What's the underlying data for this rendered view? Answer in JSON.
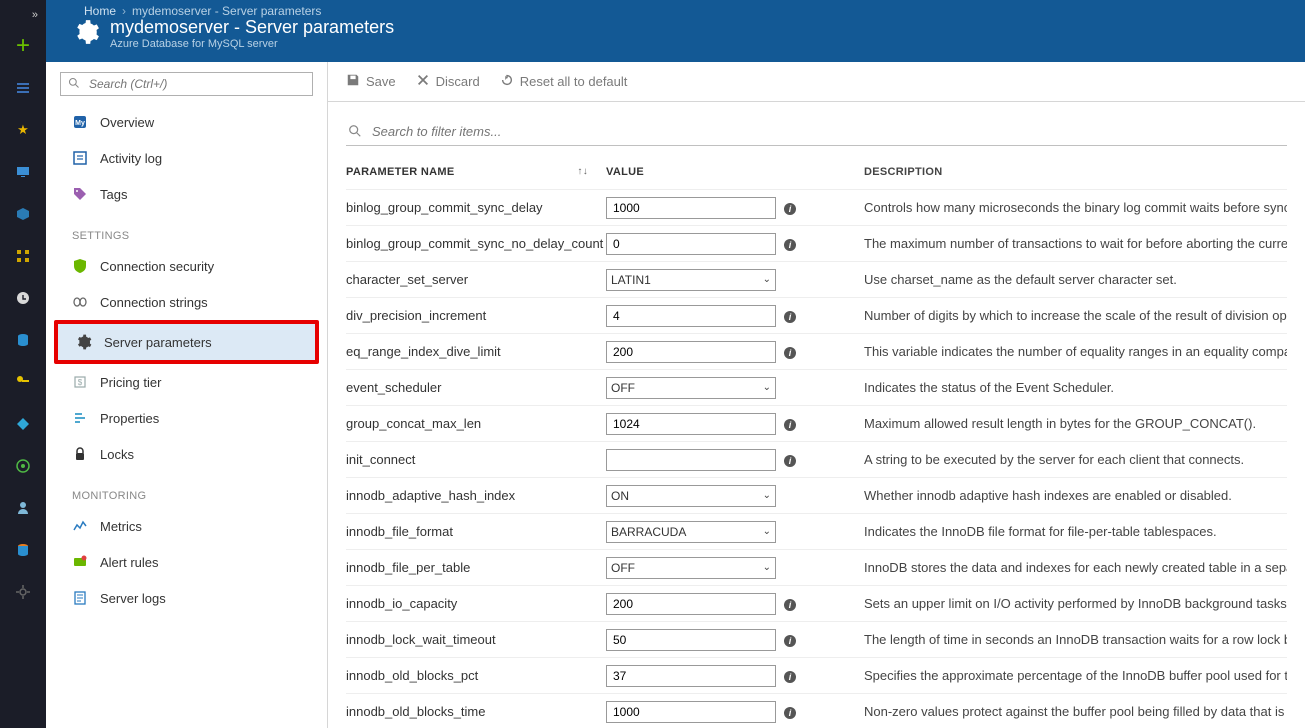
{
  "breadcrumb": {
    "home": "Home",
    "current": "mydemoserver - Server parameters"
  },
  "header": {
    "title": "mydemoserver - Server parameters",
    "subtitle": "Azure Database for MySQL server"
  },
  "sidebar": {
    "search_placeholder": "Search (Ctrl+/)",
    "top_items": [
      {
        "label": "Overview",
        "icon": "db-icon"
      },
      {
        "label": "Activity log",
        "icon": "activitylog-icon"
      },
      {
        "label": "Tags",
        "icon": "tag-icon"
      }
    ],
    "settings_label": "SETTINGS",
    "settings_items": [
      {
        "label": "Connection security",
        "icon": "shield-icon"
      },
      {
        "label": "Connection strings",
        "icon": "connstring-icon"
      },
      {
        "label": "Server parameters",
        "icon": "gear-icon",
        "active": true
      },
      {
        "label": "Pricing tier",
        "icon": "pricing-icon"
      },
      {
        "label": "Properties",
        "icon": "properties-icon"
      },
      {
        "label": "Locks",
        "icon": "lock-icon"
      }
    ],
    "monitoring_label": "MONITORING",
    "monitoring_items": [
      {
        "label": "Metrics",
        "icon": "metrics-icon"
      },
      {
        "label": "Alert rules",
        "icon": "alert-icon"
      },
      {
        "label": "Server logs",
        "icon": "logs-icon"
      }
    ]
  },
  "toolbar": {
    "save": "Save",
    "discard": "Discard",
    "reset": "Reset all to default"
  },
  "filter": {
    "placeholder": "Search to filter items..."
  },
  "grid": {
    "headers": {
      "name": "PARAMETER NAME",
      "value": "VALUE",
      "desc": "DESCRIPTION"
    },
    "rows": [
      {
        "name": "binlog_group_commit_sync_delay",
        "type": "text",
        "value": "1000",
        "desc": "Controls how many microseconds the binary log commit waits before synchronizin"
      },
      {
        "name": "binlog_group_commit_sync_no_delay_count",
        "type": "text",
        "value": "0",
        "desc": "The maximum number of transactions to wait for before aborting the current dela"
      },
      {
        "name": "character_set_server",
        "type": "select",
        "value": "LATIN1",
        "desc": "Use charset_name as the default server character set."
      },
      {
        "name": "div_precision_increment",
        "type": "text",
        "value": "4",
        "desc": "Number of digits by which to increase the scale of the result of division operations"
      },
      {
        "name": "eq_range_index_dive_limit",
        "type": "text",
        "value": "200",
        "desc": "This variable indicates the number of equality ranges in an equality comparison co"
      },
      {
        "name": "event_scheduler",
        "type": "select",
        "value": "OFF",
        "desc": "Indicates the status of the Event Scheduler."
      },
      {
        "name": "group_concat_max_len",
        "type": "text",
        "value": "1024",
        "desc": "Maximum allowed result length in bytes for the GROUP_CONCAT()."
      },
      {
        "name": "init_connect",
        "type": "text",
        "value": "",
        "desc": "A string to be executed by the server for each client that connects."
      },
      {
        "name": "innodb_adaptive_hash_index",
        "type": "select",
        "value": "ON",
        "desc": "Whether innodb adaptive hash indexes are enabled or disabled."
      },
      {
        "name": "innodb_file_format",
        "type": "select",
        "value": "BARRACUDA",
        "desc": "Indicates the InnoDB file format for file-per-table tablespaces."
      },
      {
        "name": "innodb_file_per_table",
        "type": "select",
        "value": "OFF",
        "desc": "InnoDB stores the data and indexes for each newly created table in a separate .ibd"
      },
      {
        "name": "innodb_io_capacity",
        "type": "text",
        "value": "200",
        "desc": "Sets an upper limit on I/O activity performed by InnoDB background tasks, such as"
      },
      {
        "name": "innodb_lock_wait_timeout",
        "type": "text",
        "value": "50",
        "desc": "The length of time in seconds an InnoDB transaction waits for a row lock before gi"
      },
      {
        "name": "innodb_old_blocks_pct",
        "type": "text",
        "value": "37",
        "desc": "Specifies the approximate percentage of the InnoDB buffer pool used for the old b"
      },
      {
        "name": "innodb_old_blocks_time",
        "type": "text",
        "value": "1000",
        "desc": "Non-zero values protect against the buffer pool being filled by data that is referen"
      }
    ]
  }
}
